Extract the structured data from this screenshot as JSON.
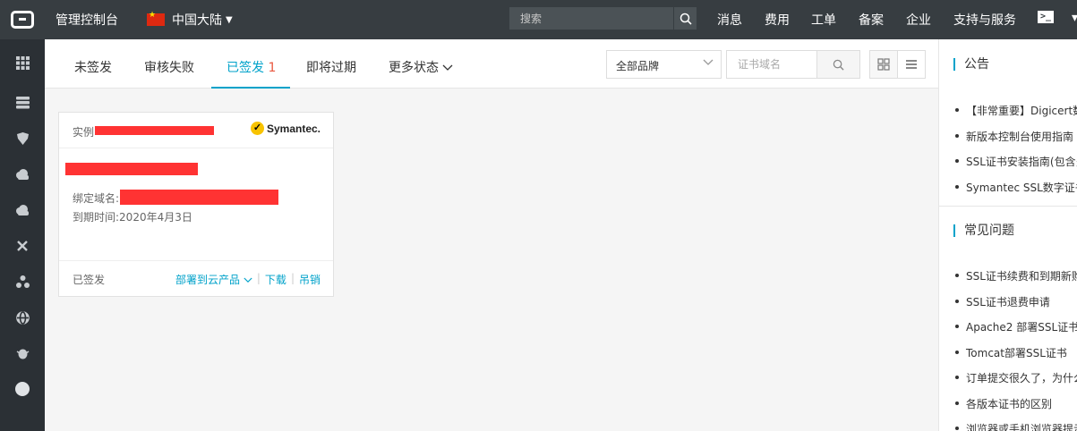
{
  "topbar": {
    "console_label": "管理控制台",
    "region": "中国大陆",
    "search_placeholder": "搜索",
    "nav": [
      "消息",
      "费用",
      "工单",
      "备案",
      "企业",
      "支持与服务"
    ],
    "terminal_label": ">_"
  },
  "tabs": [
    {
      "label": "未签发"
    },
    {
      "label": "审核失败"
    },
    {
      "label": "已签发",
      "count": "1"
    },
    {
      "label": "即将过期"
    },
    {
      "label": "更多状态"
    }
  ],
  "filters": {
    "brand_select": "全部品牌",
    "search_placeholder": "证书域名"
  },
  "card": {
    "instance_label": "实例",
    "brand": "Symantec.",
    "domain_label": "绑定域名:",
    "expiry_label": "到期时间:",
    "expiry_value": "2020年4月3日",
    "status": "已签发",
    "actions": {
      "deploy": "部署到云产品",
      "download": "下载",
      "revoke": "吊销"
    }
  },
  "announcements": {
    "title": "公告",
    "items": [
      "【非常重要】Digicert数",
      "新版本控制台使用指南",
      "SSL证书安装指南(包含多",
      "Symantec SSL数字证书"
    ]
  },
  "faq": {
    "title": "常见问题",
    "items": [
      "SSL证书续费和到期新购",
      "SSL证书退费申请",
      "Apache2 部署SSL证书",
      "Tomcat部署SSL证书",
      "订单提交很久了，为什么",
      "各版本证书的区别",
      "浏览器或手机浏览器提示"
    ]
  },
  "colors": {
    "accent": "#00a2ca",
    "topbar": "#373d41",
    "sidebar": "#2b3035",
    "redaction": "#ff3333",
    "count": "#e9573f"
  },
  "sidebar_icons": [
    "grid-icon",
    "server-icon",
    "shield-icon",
    "cloud-icon",
    "cloud-upload-icon",
    "network-icon",
    "cluster-icon",
    "globe-icon",
    "bug-icon",
    "circle-icon"
  ]
}
